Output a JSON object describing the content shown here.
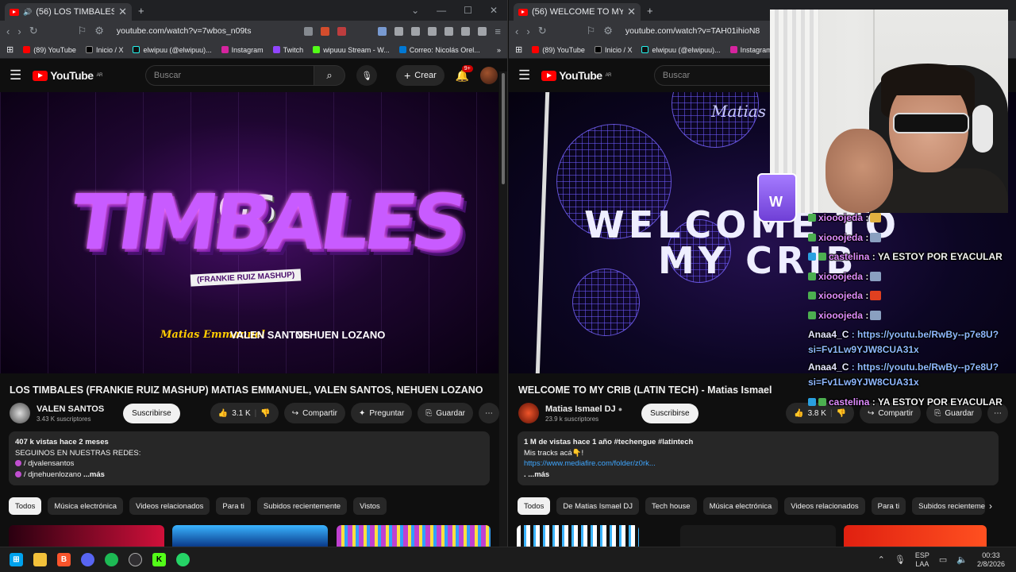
{
  "left_window": {
    "tab_title": "(56) LOS TIMBALES (FRANKIE",
    "url": "youtube.com/watch?v=7wbos_n09ts",
    "bookmarks": [
      "(89) YouTube",
      "Inicio / X",
      "elwipuu (@elwipuu)...",
      "Instagram",
      "Twitch",
      "wipuuu Stream - W...",
      "Correo: Nicolás Orel..."
    ],
    "search_placeholder": "Buscar",
    "crear_label": "Crear",
    "notif_badge": "9+",
    "region": "AR",
    "art": {
      "line1": "LOS",
      "line2": "TIMBALES",
      "subtitle": "(FRANKIE RUIZ MASHUP)",
      "credit1": "Matias Emmanuel",
      "credit2": "VALEN SANTOS",
      "credit3": "NEHUEN LOZANO"
    },
    "video_title": "LOS TIMBALES (FRANKIE RUIZ MASHUP) MATIAS EMMANUEL, VALEN SANTOS, NEHUEN LOZANO",
    "channel_name": "VALEN SANTOS",
    "channel_subs": "3.43 K suscriptores",
    "subscribe_label": "Suscribirse",
    "likes": "3.1 K",
    "share_label": "Compartir",
    "ask_label": "Preguntar",
    "save_label": "Guardar",
    "desc_stats": "407 k vistas  hace 2 meses",
    "desc_line2": "SEGUINOS EN NUESTRAS REDES:",
    "desc_link1": "/ djvalensantos",
    "desc_link2": "/ djnehuenlozano",
    "desc_more": "...más",
    "chips": [
      "Todos",
      "Música electrónica",
      "Videos relacionados",
      "Para ti",
      "Subidos recientemente",
      "Vistos"
    ]
  },
  "right_window": {
    "tab_title": "(56) WELCOME TO MY CRIB (LAT",
    "url": "youtube.com/watch?v=TAH01ihioN8",
    "bookmarks": [
      "(89) YouTube",
      "Inicio / X",
      "elwipuu (@elwipuu)...",
      "Instagram"
    ],
    "search_placeholder": "Buscar",
    "region": "AR",
    "art": {
      "artist": "Matias Is",
      "line1": "WELCOME TO",
      "line2": "MY CRIB"
    },
    "video_title": "WELCOME TO MY CRIB (LATIN TECH) - Matias Ismael",
    "channel_name": "Matias Ismael DJ",
    "channel_subs": "23.9 k suscriptores",
    "subscribe_label": "Suscribirse",
    "likes": "3.8 K",
    "share_label": "Compartir",
    "save_label": "Guardar",
    "desc_stats": "1 M de vistas  hace 1 año  #techengue #latintech",
    "desc_line2": "Mis tracks acá👇!",
    "desc_link": "https://www.mediafire.com/folder/z0rk...",
    "desc_more": ". ...más",
    "chips": [
      "Todos",
      "De Matias Ismael DJ",
      "Tech house",
      "Música electrónica",
      "Videos relacionados",
      "Para ti",
      "Subidos recienteme"
    ]
  },
  "overlay_chat": {
    "cup_letter": "W",
    "messages": [
      {
        "user": "xiooojeda",
        "text": ":"
      },
      {
        "user": "xiooojeda",
        "text": ":"
      },
      {
        "user": "castelina",
        "text": ": YA ESTOY POR EYACULAR"
      },
      {
        "user": "xiooojeda",
        "text": ":"
      },
      {
        "user": "xiooojeda",
        "text": ":"
      },
      {
        "user": "xiooojeda",
        "text": ":"
      },
      {
        "user": "Anaa4_C",
        "text": ": https://youtu.be/RwBy--p7e8U?si=Fv1Lw9YJW8CUA31x"
      },
      {
        "user": "Anaa4_C",
        "text": ": https://youtu.be/RwBy--p7e8U?si=Fv1Lw9YJW8CUA31x"
      },
      {
        "user": "castelina",
        "text": ": YA ESTOY POR EYACULAR"
      }
    ]
  },
  "taskbar": {
    "lang_line1": "ESP",
    "lang_line2": "LAA",
    "time": "00:33",
    "date": "2/8/2026"
  },
  "colors": {
    "yt_red": "#ff0000",
    "chat_pink": "#e08cff",
    "link_blue": "#3ea6ff"
  }
}
